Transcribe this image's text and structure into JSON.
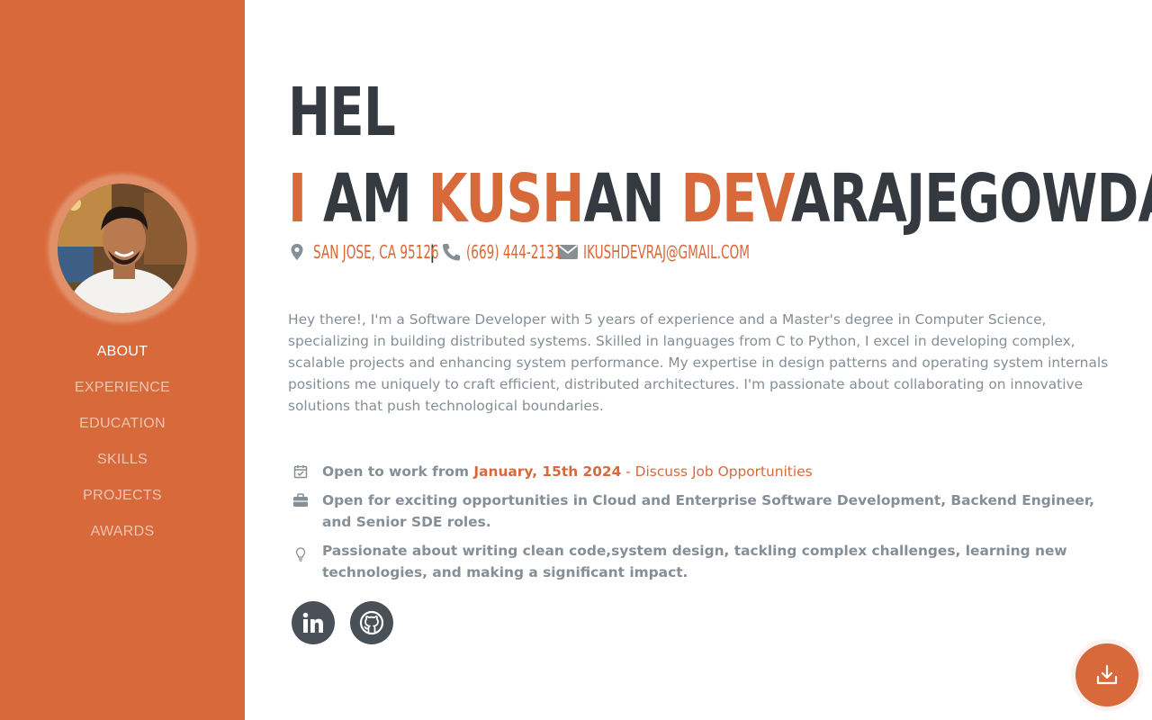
{
  "sidebar": {
    "nav": [
      {
        "label": "ABOUT",
        "active": true
      },
      {
        "label": "EXPERIENCE",
        "active": false
      },
      {
        "label": "EDUCATION",
        "active": false
      },
      {
        "label": "SKILLS",
        "active": false
      },
      {
        "label": "PROJECTS",
        "active": false
      },
      {
        "label": "AWARDS",
        "active": false
      }
    ]
  },
  "hero": {
    "line1": "HEL",
    "line2_parts": [
      "I",
      " AM ",
      "KUSH",
      "AN ",
      "DEV",
      "ARAJEGOWDA"
    ]
  },
  "contact": {
    "address": "San Jose, CA 95126",
    "separator": "|",
    "phone": "(669) 444-2131",
    "email": "ikushdevraj@gmail.com"
  },
  "about": {
    "intro": "Hey there!, I'm a Software Developer with 5 years of experience and a Master's degree in Computer Science, specializing in building distributed systems. Skilled in languages from C to Python, I excel in developing complex, scalable projects and enhancing system performance. My expertise in design patterns and operating system internals positions me uniquely to craft efficient, distributed architectures. I'm passionate about collaborating on innovative solutions that push technological boundaries."
  },
  "facts": {
    "open_to_work_prefix": "Open to work from ",
    "open_to_work_date": "January, 15th 2024",
    "jobs_link": " - Discuss Job Opportunities",
    "roles": "Open for exciting opportunities in Cloud and Enterprise Software Development, Backend Engineer, and Senior SDE roles.",
    "passion": "Passionate about writing clean code,system design, tackling complex challenges, learning new technologies, and making a significant impact."
  },
  "social": {
    "linkedin_icon": "linkedin-icon",
    "github_icon": "github-icon"
  },
  "download": {
    "icon": "download-icon"
  },
  "colors": {
    "accent": "#d8693a",
    "dark": "#343a40",
    "muted": "#868e96",
    "social_bg": "#495057"
  }
}
